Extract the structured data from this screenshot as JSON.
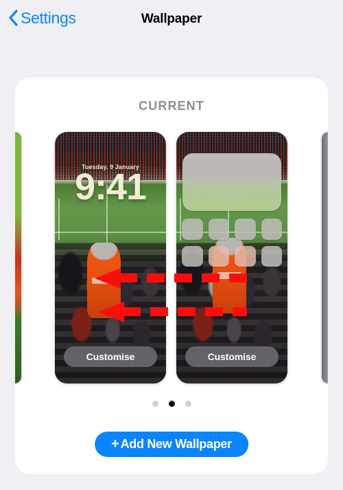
{
  "navbar": {
    "back_label": "Settings",
    "back_icon": "chevron-left-icon",
    "title": "Wallpaper"
  },
  "card": {
    "section_title": "CURRENT"
  },
  "previews": {
    "lock_screen": {
      "name": "lock-screen-preview",
      "date": "Tuesday, 9 January",
      "time": "9:41",
      "customise_label": "Customise"
    },
    "home_screen": {
      "name": "home-screen-preview",
      "customise_label": "Customise",
      "widget": "blurred-widget",
      "icon_count": 8
    },
    "neighbour_left": "nature-wallpaper-sliver",
    "neighbour_right": "grey-wallpaper-sliver"
  },
  "pagination": {
    "total": 3,
    "active_index": 1
  },
  "add_button": {
    "plus": "+",
    "label": "Add New Wallpaper"
  },
  "annotations": {
    "arrow_one": "red-arrow-pointing-left-upper",
    "arrow_two": "red-arrow-pointing-left-lower",
    "color": "#fb0d0d"
  },
  "colors": {
    "page_background": "#f0eff4",
    "card_background": "#ffffff",
    "accent_blue": "#0a84ff",
    "section_title": "#8e8e93",
    "annotation_red": "#fb0d0d"
  }
}
